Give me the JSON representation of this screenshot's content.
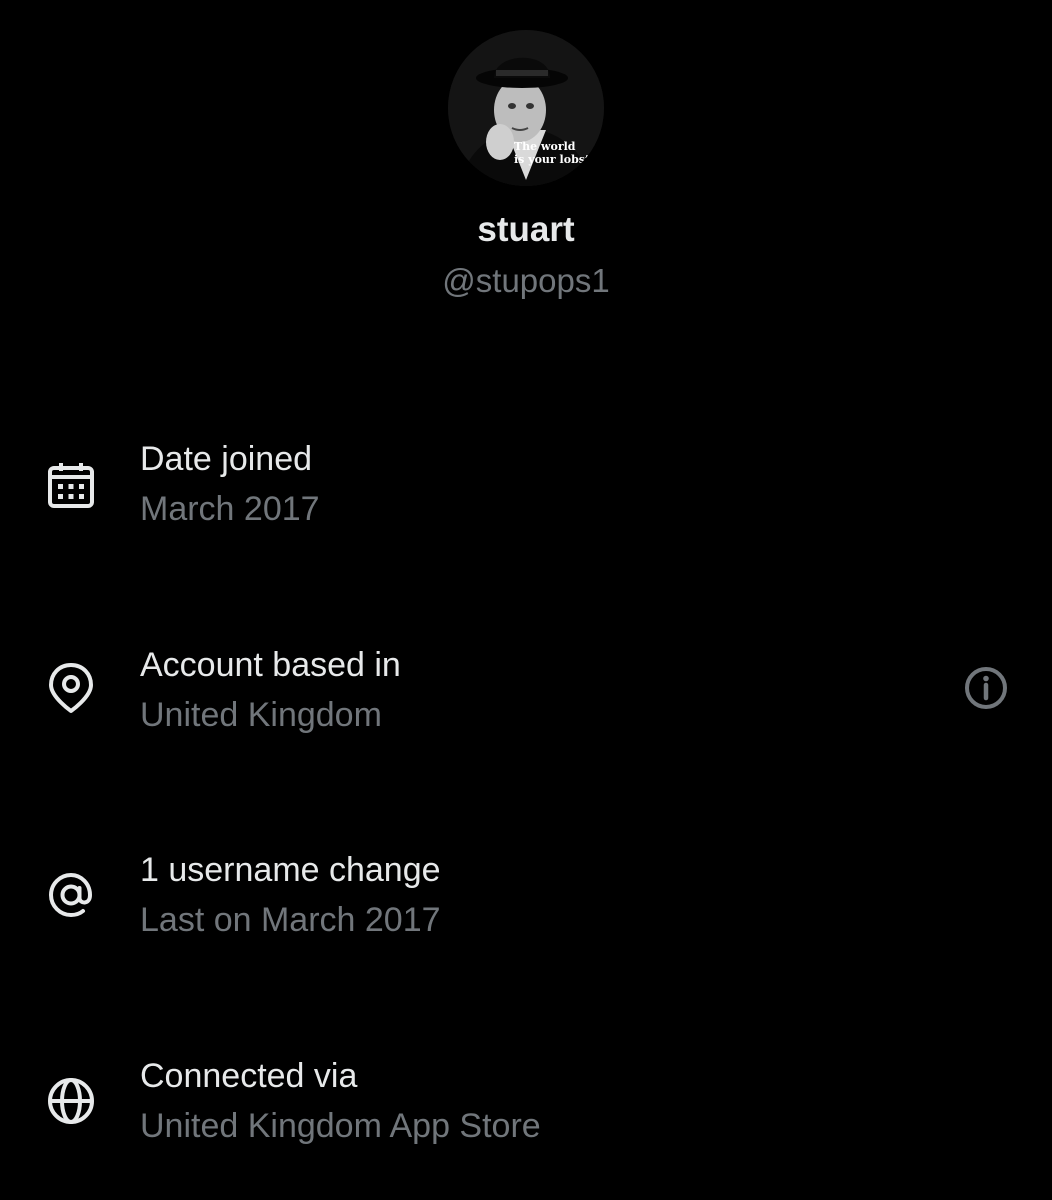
{
  "profile": {
    "display_name": "stuart",
    "handle": "@stupops1",
    "avatar_caption": "The world\nis your lobste"
  },
  "rows": [
    {
      "icon": "calendar-icon",
      "title": "Date joined",
      "subtitle": "March 2017"
    },
    {
      "icon": "location-pin-icon",
      "title": "Account based in",
      "subtitle": "United Kingdom",
      "trailing_icon": "info-icon"
    },
    {
      "icon": "at-sign-icon",
      "title": "1 username change",
      "subtitle": "Last on March 2017"
    },
    {
      "icon": "globe-icon",
      "title": "Connected via",
      "subtitle": "United Kingdom App Store"
    }
  ],
  "colors": {
    "background": "#000000",
    "primary_text": "#e7e9ea",
    "secondary_text": "#71767b"
  }
}
